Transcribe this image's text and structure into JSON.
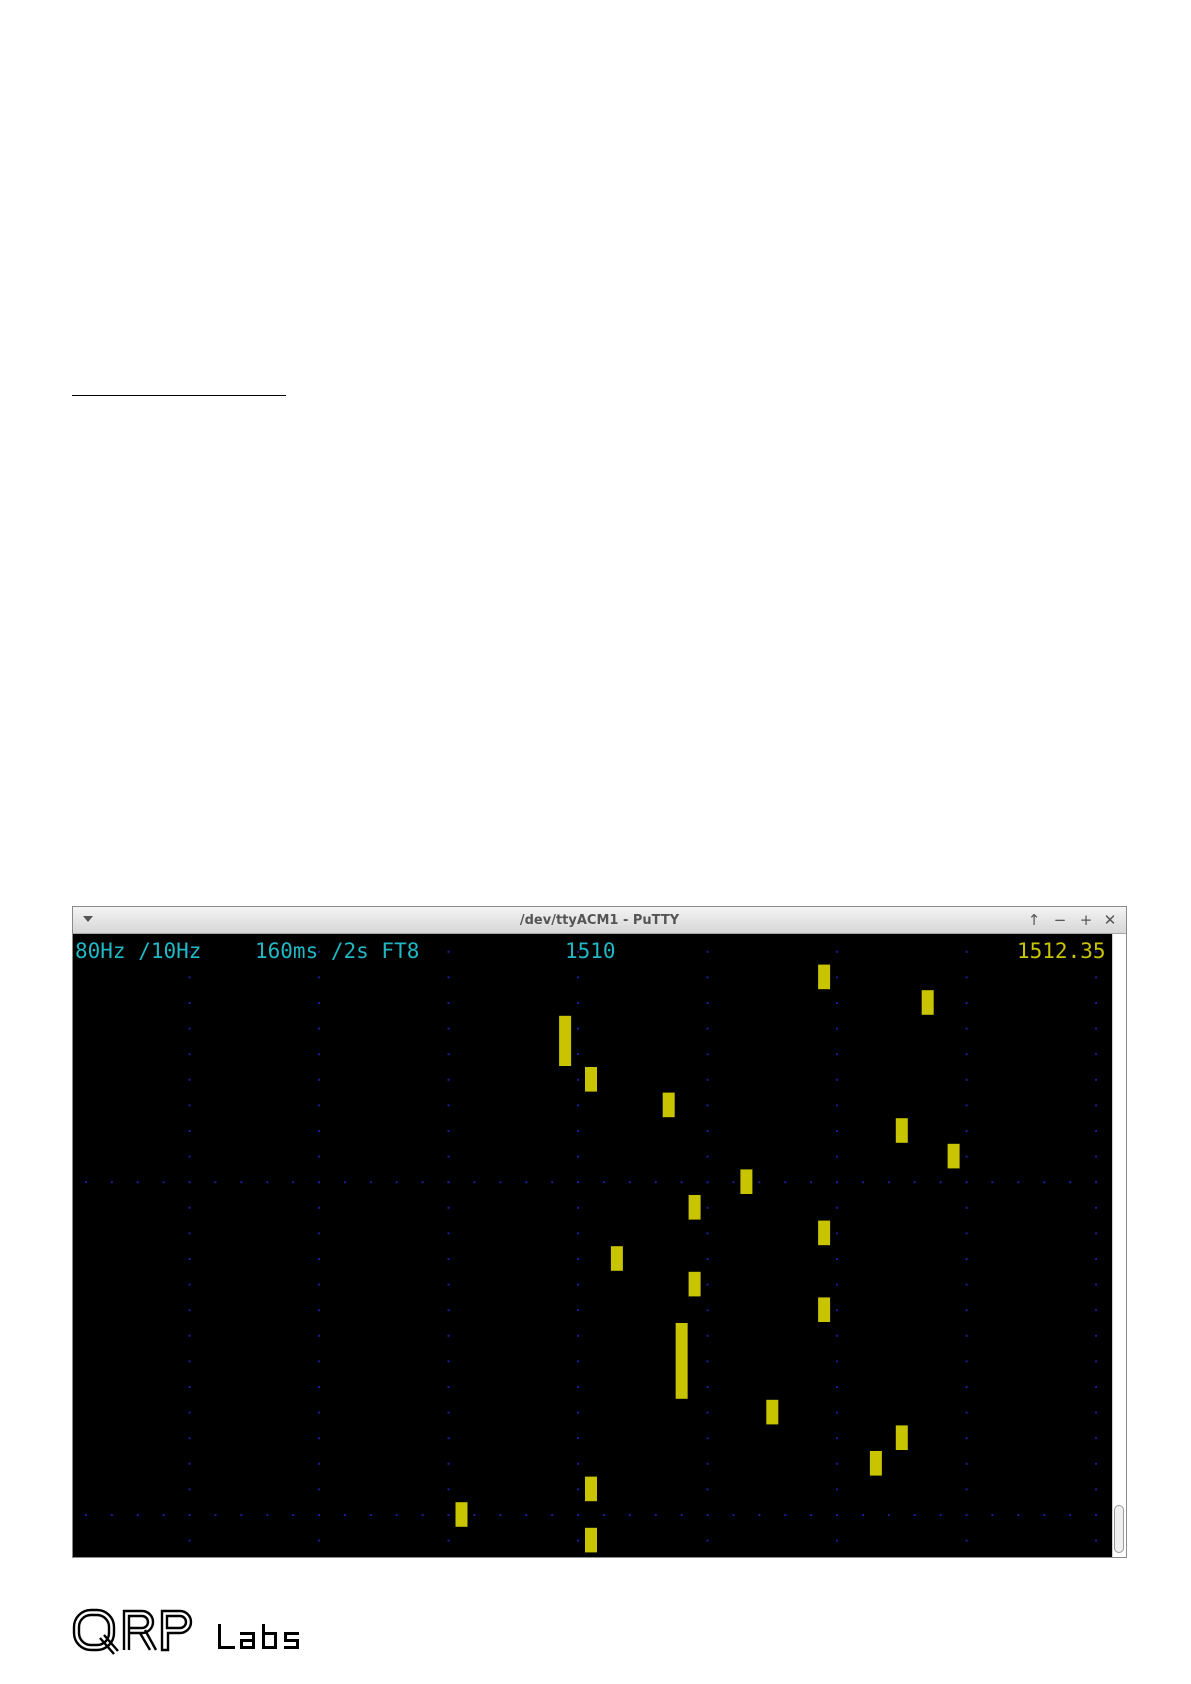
{
  "window": {
    "title": "/dev/ttyACM1 - PuTTY",
    "controls": [
      "menu",
      "raise",
      "minimize",
      "maximize",
      "close"
    ]
  },
  "terminal": {
    "status_left": "80Hz /10Hz",
    "status_mid": "160ms /2s FT8",
    "center_label": "1510",
    "right_label": "1512.35",
    "colors": {
      "background": "#000000",
      "text": "#1fb8c4",
      "readout": "#c9c400",
      "signal": "#c9c400",
      "grid_dots": "#1c1c9c"
    },
    "signal_blocks": [
      {
        "col": 29,
        "row": 1,
        "rows": 1
      },
      {
        "col": 33,
        "row": 2,
        "rows": 1
      },
      {
        "col": 19,
        "row": 3,
        "rows": 2
      },
      {
        "col": 20,
        "row": 5,
        "rows": 1
      },
      {
        "col": 23,
        "row": 6,
        "rows": 1
      },
      {
        "col": 32,
        "row": 7,
        "rows": 1
      },
      {
        "col": 34,
        "row": 8,
        "rows": 1
      },
      {
        "col": 26,
        "row": 9,
        "rows": 1
      },
      {
        "col": 24,
        "row": 10,
        "rows": 1
      },
      {
        "col": 29,
        "row": 11,
        "rows": 1
      },
      {
        "col": 21,
        "row": 12,
        "rows": 1
      },
      {
        "col": 24,
        "row": 13,
        "rows": 1
      },
      {
        "col": 29,
        "row": 14,
        "rows": 1
      },
      {
        "col": 23.5,
        "row": 15,
        "rows": 3
      },
      {
        "col": 27,
        "row": 18,
        "rows": 1
      },
      {
        "col": 32,
        "row": 19,
        "rows": 1
      },
      {
        "col": 31,
        "row": 20,
        "rows": 1
      },
      {
        "col": 20,
        "row": 21,
        "rows": 1
      },
      {
        "col": 15,
        "row": 22,
        "rows": 1
      },
      {
        "col": 20,
        "row": 23,
        "rows": 1
      }
    ]
  },
  "brand": {
    "logo_text": "QRP",
    "suffix": "Labs"
  }
}
